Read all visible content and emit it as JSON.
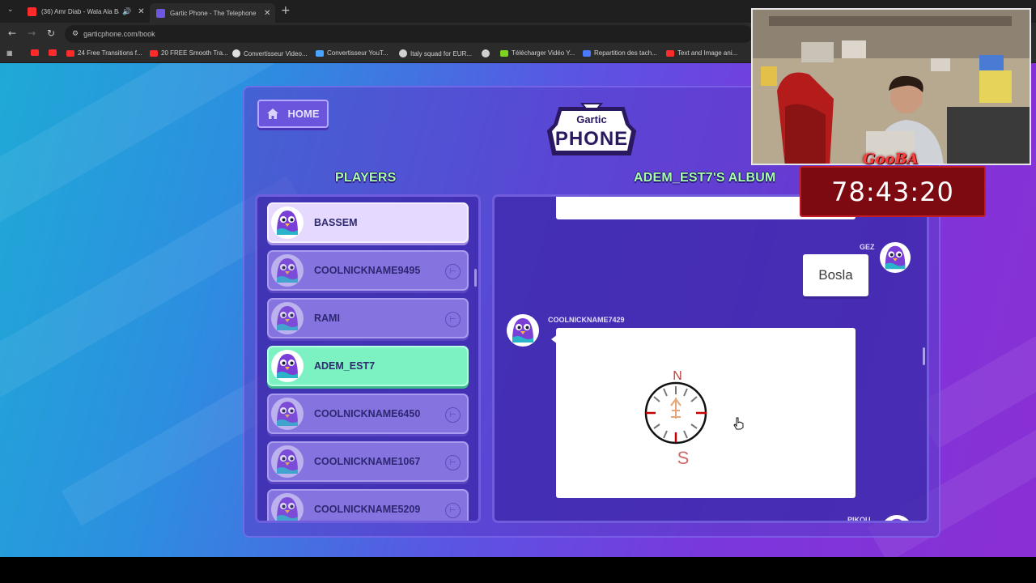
{
  "browser": {
    "tabs": [
      {
        "title": "(36) Amr Diab - Wala Ala Ba",
        "active": false,
        "favicon_color": "#ff2b2b"
      },
      {
        "title": "Gartic Phone - The Telephone G",
        "active": true,
        "favicon_color": "#6d57e0"
      }
    ],
    "close_glyph": "✕",
    "new_tab_glyph": "+",
    "url": "garticphone.com/book",
    "bookmarks": [
      {
        "label": "",
        "icon_color": "#ff2b2b"
      },
      {
        "label": "",
        "icon_color": "#ff2b2b"
      },
      {
        "label": "24 Free Transitions f...",
        "icon_color": "#ff2b2b"
      },
      {
        "label": "20 FREE Smooth Tra...",
        "icon_color": "#ff2b2b"
      },
      {
        "label": "Convertisseur Video...",
        "icon_color": "#e0e0e0"
      },
      {
        "label": "Convertisseur YouT...",
        "icon_color": "#4aa3ff"
      },
      {
        "label": "Italy squad for EUR...",
        "icon_color": "#d0d0d0"
      },
      {
        "label": "",
        "icon_color": "#d0d0d0"
      },
      {
        "label": "Télécharger Vidéo Y...",
        "icon_color": "#7ed321"
      },
      {
        "label": "Repartition des tach...",
        "icon_color": "#4a7bff"
      },
      {
        "label": "Text and Image ani...",
        "icon_color": "#ff2b2b"
      }
    ]
  },
  "game": {
    "home_label": "HOME",
    "logo_top": "Gartic",
    "logo_bottom": "PHONE",
    "players_title": "PLAYERS",
    "album_title": "ADEM_EST7'S ALBUM",
    "players": [
      {
        "name": "BASSEM",
        "state": "selected",
        "kickable": false
      },
      {
        "name": "COOLNICKNAME9495",
        "state": "normal",
        "kickable": true
      },
      {
        "name": "RAMI",
        "state": "normal",
        "kickable": true
      },
      {
        "name": "ADEM_EST7",
        "state": "current",
        "kickable": false
      },
      {
        "name": "COOLNICKNAME6450",
        "state": "normal",
        "kickable": true
      },
      {
        "name": "COOLNICKNAME1067",
        "state": "normal",
        "kickable": true
      },
      {
        "name": "COOLNICKNAME5209",
        "state": "normal",
        "kickable": true
      }
    ],
    "album": {
      "guess_author": "GEZ",
      "guess_text": "Bosla",
      "drawing_author": "COOLNICKNAME7429",
      "drawing_letter_top": "N",
      "drawing_letter_bottom": "S",
      "next_author": "PIKOU"
    }
  },
  "stream_overlay": {
    "streamer_tag": "GooBA",
    "timer": "78:43:20"
  },
  "colors": {
    "accent_green": "#a6ffa6",
    "current_player": "#7cf2c3",
    "selected_player": "#e5d9ff",
    "timer_bg": "#7d0a10"
  }
}
